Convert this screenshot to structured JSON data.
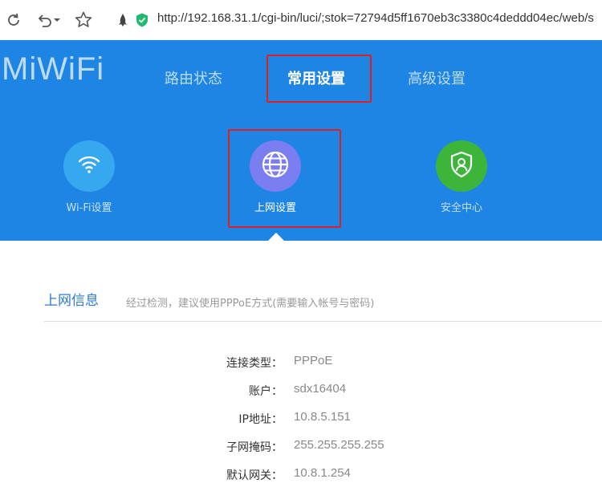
{
  "browser": {
    "url": "http://192.168.31.1/cgi-bin/luci/;stok=72794d5ff1670eb3c3380c4deddd04ec/web/s",
    "icons": [
      "reload-icon",
      "undo-icon",
      "dropdown-icon",
      "star-icon",
      "extension-icon",
      "shield-icon"
    ]
  },
  "header": {
    "logo": "MiWiFi",
    "nav": [
      {
        "label": "路由状态",
        "active": false
      },
      {
        "label": "常用设置",
        "active": true
      },
      {
        "label": "高级设置",
        "active": false
      }
    ],
    "sub_nav": [
      {
        "label": "Wi-Fi设置",
        "icon": "wifi-icon",
        "color": "#35a8ef",
        "active": false
      },
      {
        "label": "上网设置",
        "icon": "globe-icon",
        "color": "#7b7ef0",
        "active": true
      },
      {
        "label": "安全中心",
        "icon": "shield-user-icon",
        "color": "#3db53a",
        "active": false
      }
    ],
    "background": "#1e85e4",
    "highlight_color": "#e02020"
  },
  "content": {
    "section_title": "上网信息",
    "section_note": "经过检测，建议使用PPPoE方式(需要输入帐号与密码)",
    "rows": [
      {
        "label": "连接类型：",
        "value": "PPPoE"
      },
      {
        "label": "账户：",
        "value": "sdx16404"
      },
      {
        "label": "IP地址：",
        "value": "10.8.5.151"
      },
      {
        "label": "子网掩码：",
        "value": "255.255.255.255"
      },
      {
        "label": "默认网关：",
        "value": "10.8.1.254"
      }
    ]
  }
}
